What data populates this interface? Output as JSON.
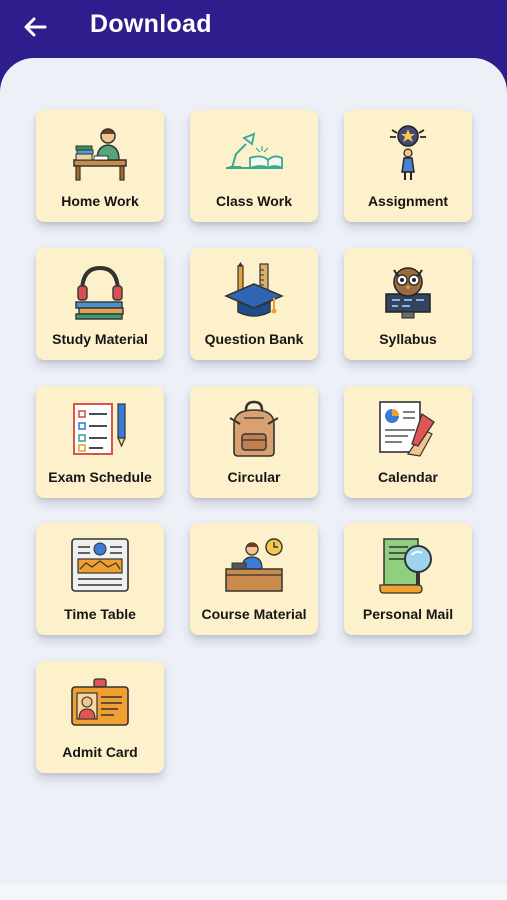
{
  "header": {
    "title": "Download",
    "back_icon": "arrow-left-icon"
  },
  "colors": {
    "header_bg": "#2e1d8c",
    "content_bg": "#edf0f7",
    "tile_bg": "#fdf1cc"
  },
  "tiles": [
    {
      "label": "Home Work",
      "icon": "student-desk-icon"
    },
    {
      "label": "Class Work",
      "icon": "desk-lamp-book-icon"
    },
    {
      "label": "Assignment",
      "icon": "idea-person-icon"
    },
    {
      "label": "Study Material",
      "icon": "headphones-books-icon"
    },
    {
      "label": "Question Bank",
      "icon": "graduation-cap-icon"
    },
    {
      "label": "Syllabus",
      "icon": "owl-monitor-icon"
    },
    {
      "label": "Exam Schedule",
      "icon": "checklist-icon"
    },
    {
      "label": "Circular",
      "icon": "backpack-icon"
    },
    {
      "label": "Calendar",
      "icon": "document-pen-icon"
    },
    {
      "label": "Time Table",
      "icon": "newspaper-icon"
    },
    {
      "label": "Course Material",
      "icon": "teacher-desk-clock-icon"
    },
    {
      "label": "Personal Mail",
      "icon": "document-magnifier-icon"
    },
    {
      "label": "Admit Card",
      "icon": "id-card-icon"
    }
  ]
}
